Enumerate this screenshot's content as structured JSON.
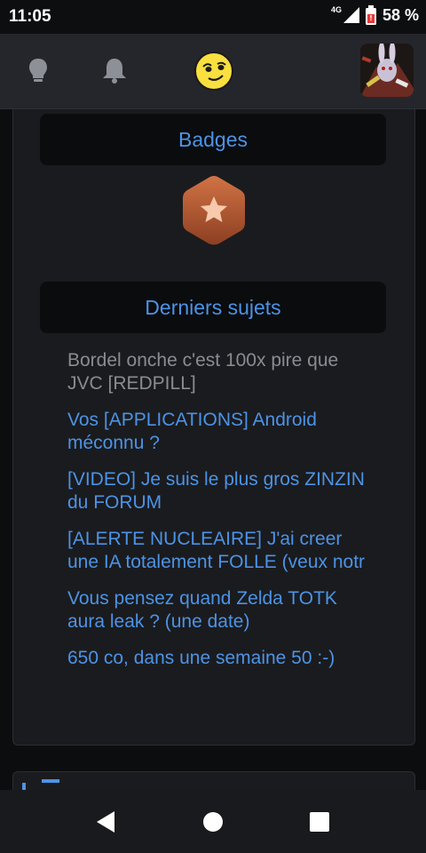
{
  "status": {
    "time": "11:05",
    "network": "4G",
    "battery": "58 %"
  },
  "header": {
    "icons": [
      "lightbulb-icon",
      "bell-icon",
      "smiley-icon"
    ],
    "accent": "#4c93e6"
  },
  "badges": {
    "title": "Badges",
    "badge_color": "#c0633a"
  },
  "topics": {
    "title": "Derniers sujets",
    "items": [
      {
        "label": "Bordel onche c'est 100x pire que JVC [REDPILL]",
        "visited": true
      },
      {
        "label": "Vos [APPLICATIONS] Android méconnu ?",
        "visited": false
      },
      {
        "label": "[VIDEO] Je suis le plus gros ZINZIN du FORUM",
        "visited": false
      },
      {
        "label": "[ALERTE NUCLEAIRE] J'ai creer une IA totalement FOLLE (veux notr",
        "visited": false
      },
      {
        "label": "Vous pensez quand Zelda TOTK aura leak ? (une date)",
        "visited": false
      },
      {
        "label": "650 co, dans une semaine 50 :-)",
        "visited": false
      }
    ]
  },
  "navbar": {
    "buttons": [
      "back-icon",
      "home-icon",
      "recents-icon"
    ]
  }
}
